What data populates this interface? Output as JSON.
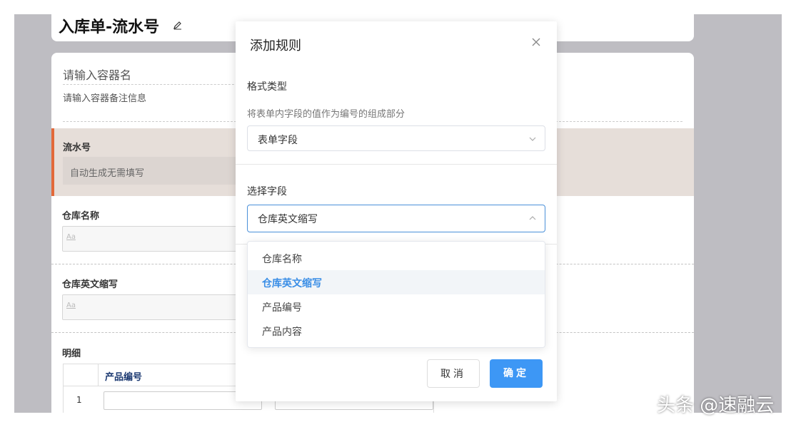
{
  "page": {
    "title": "入库单-流水号",
    "container_name_placeholder": "请输入容器名",
    "container_note_placeholder": "请输入容器备注信息"
  },
  "fields": {
    "serial_label": "流水号",
    "serial_value": "自动生成无需填写",
    "warehouse_name_label": "仓库名称",
    "warehouse_en_label": "仓库英文缩写",
    "aa_hint": "Aa",
    "detail_label": "明细"
  },
  "table": {
    "col_product_code": "产品编号",
    "row1_num": "1"
  },
  "modal": {
    "title": "添加规则",
    "format_type_label": "格式类型",
    "format_type_hint": "将表单内字段的值作为编号的组成部分",
    "format_type_value": "表单字段",
    "select_field_label": "选择字段",
    "select_field_value": "仓库英文缩写",
    "options": [
      "仓库名称",
      "仓库英文缩写",
      "产品编号",
      "产品内容"
    ],
    "cancel_label": "取消",
    "ok_label": "确定"
  },
  "watermark": "头条 @速融云",
  "colors": {
    "accent": "#3d97f5",
    "serial_bar": "#e2693a"
  }
}
